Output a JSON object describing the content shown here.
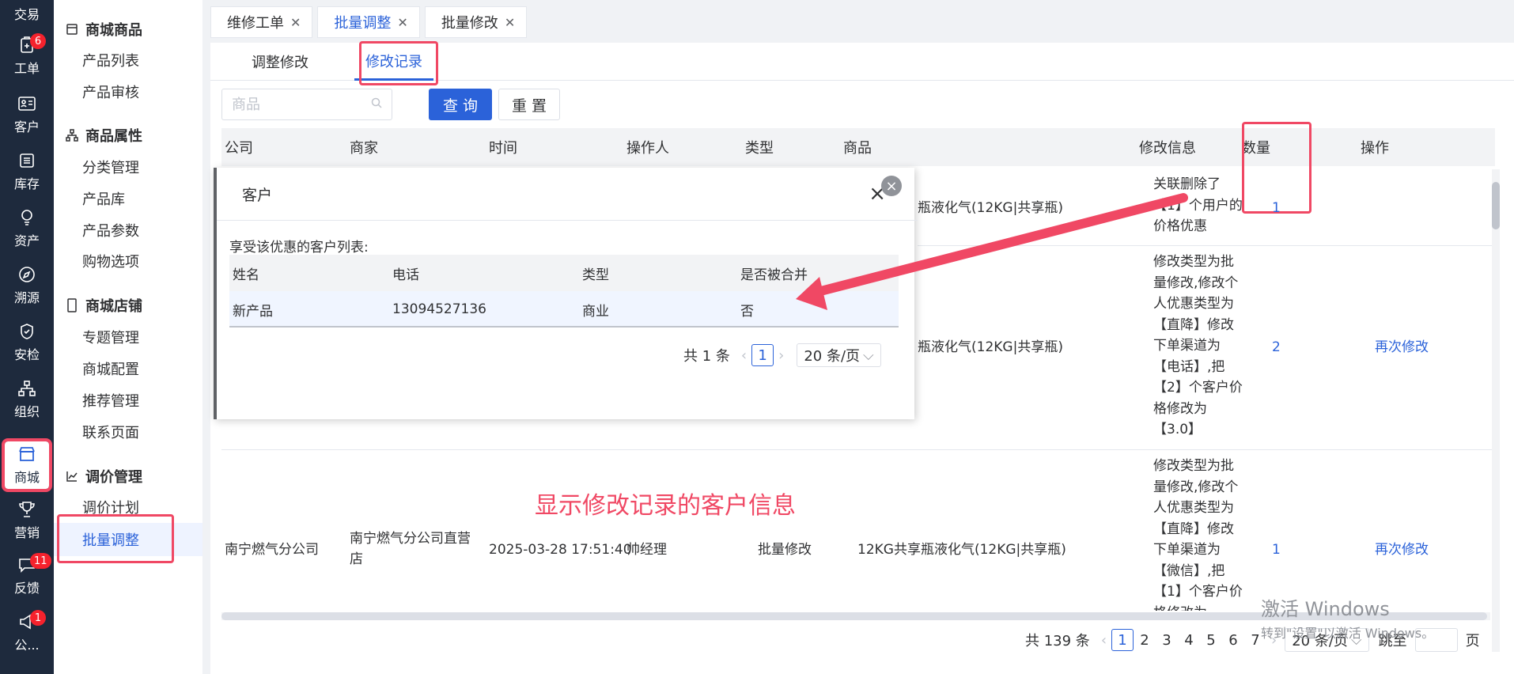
{
  "rail": [
    {
      "label": "交易",
      "icon": "trade-icon",
      "badge": ""
    },
    {
      "label": "工单",
      "icon": "workorder-icon",
      "badge": "6"
    },
    {
      "label": "客户",
      "icon": "customer-icon",
      "badge": ""
    },
    {
      "label": "库存",
      "icon": "inventory-icon",
      "badge": ""
    },
    {
      "label": "资产",
      "icon": "asset-icon",
      "badge": ""
    },
    {
      "label": "溯源",
      "icon": "trace-icon",
      "badge": ""
    },
    {
      "label": "安检",
      "icon": "safety-icon",
      "badge": ""
    },
    {
      "label": "组织",
      "icon": "org-icon",
      "badge": ""
    },
    {
      "label": "商城",
      "icon": "mall-icon",
      "badge": ""
    },
    {
      "label": "营销",
      "icon": "trophy-icon",
      "badge": ""
    },
    {
      "label": "反馈",
      "icon": "feedback-icon",
      "badge": "11"
    },
    {
      "label": "公...",
      "icon": "announce-icon",
      "badge": "1"
    }
  ],
  "sidebar": {
    "groups": [
      {
        "title": "商城商品",
        "items": [
          "产品列表",
          "产品审核"
        ]
      },
      {
        "title": "商品属性",
        "items": [
          "分类管理",
          "产品库",
          "产品参数",
          "购物选项"
        ]
      },
      {
        "title": "商城店铺",
        "items": [
          "专题管理",
          "商城配置",
          "推荐管理",
          "联系页面"
        ]
      },
      {
        "title": "调价管理",
        "items": [
          "调价计划",
          "批量调整"
        ]
      }
    ]
  },
  "tabs": [
    {
      "label": "维修工单"
    },
    {
      "label": "批量调整"
    },
    {
      "label": "批量修改"
    }
  ],
  "subtabs": [
    "调整修改",
    "修改记录"
  ],
  "search": {
    "placeholder": "商品",
    "query_label": "查 询",
    "reset_label": "重 置"
  },
  "table": {
    "headers": [
      "公司",
      "商家",
      "时间",
      "操作人",
      "类型",
      "商品",
      "修改信息",
      "数量",
      "操作"
    ],
    "rows": [
      {
        "company": "",
        "merchant": "",
        "time": "",
        "operator": "",
        "type": "",
        "product": "瓶液化气(12KG|共享瓶)",
        "info": [
          "关联删除了",
          "【1】个用户的",
          "价格优惠"
        ],
        "qty": "1",
        "action": ""
      },
      {
        "company": "",
        "merchant": "",
        "time": "",
        "operator": "",
        "type": "",
        "product": "瓶液化气(12KG|共享瓶)",
        "info": [
          "修改类型为批",
          "量修改,修改个",
          "人优惠类型为",
          "【直降】修改",
          "下单渠道为",
          "【电话】,把",
          "【2】个客户价",
          "格修改为",
          "【3.0】"
        ],
        "qty": "2",
        "action": "再次修改"
      },
      {
        "company": "南宁燃气分公司",
        "merchant": [
          "南宁燃气分公司直营",
          "店"
        ],
        "time": "2025-03-28 17:51:40",
        "operator": "帅经理",
        "type": "批量修改",
        "product": "12KG共享瓶液化气(12KG|共享瓶)",
        "info": [
          "修改类型为批",
          "量修改,修改个",
          "人优惠类型为",
          "【直降】修改",
          "下单渠道为",
          "【微信】,把",
          "【1】个客户价",
          "格修改为"
        ],
        "qty": "1",
        "action": "再次修改"
      }
    ]
  },
  "popup": {
    "title": "客户",
    "description": "享受该优惠的客户列表:",
    "headers": [
      "姓名",
      "电话",
      "类型",
      "是否被合并"
    ],
    "rows": [
      {
        "name": "新产品",
        "phone": "13094527136",
        "type": "商业",
        "merged": "否"
      }
    ],
    "total": "共 1 条",
    "page": "1",
    "page_size": "20 条/页"
  },
  "annotation": "显示修改记录的客户信息",
  "pagination": {
    "total": "共 139 条",
    "pages": [
      "1",
      "2",
      "3",
      "4",
      "5",
      "6",
      "7"
    ],
    "current": "1",
    "page_size": "20 条/页",
    "jump_label": "跳至",
    "page_suffix": "页"
  },
  "watermark": {
    "line1": "激活 Windows",
    "line2": "转到\"设置\"以激活 Windows。"
  },
  "colors": {
    "accent": "#2b62d9",
    "highlight": "#f04864",
    "rail": "#1e2a3d"
  }
}
